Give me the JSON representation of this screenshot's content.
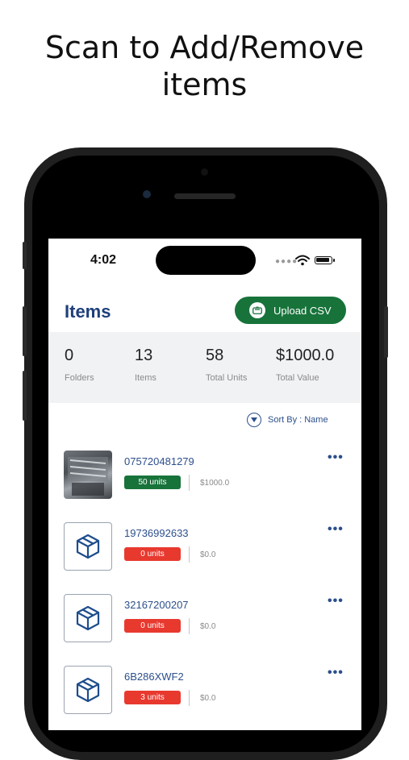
{
  "headline": "Scan to Add/Remove items",
  "status_bar": {
    "time": "4:02"
  },
  "header": {
    "title": "Items",
    "upload_label": "Upload CSV"
  },
  "stats": [
    {
      "value": "0",
      "label": "Folders"
    },
    {
      "value": "13",
      "label": "Items"
    },
    {
      "value": "58",
      "label": "Total Units"
    },
    {
      "value": "$1000.0",
      "label": "Total Value"
    }
  ],
  "sort_label": "Sort By : Name",
  "items": [
    {
      "name": "075720481279",
      "units": "50 units",
      "price": "$1000.0",
      "thumb": "photo",
      "badge_color": "#17733a"
    },
    {
      "name": "19736992633",
      "units": "0 units",
      "price": "$0.0",
      "thumb": "box-icon",
      "badge_color": "#e8392f"
    },
    {
      "name": "32167200207",
      "units": "0 units",
      "price": "$0.0",
      "thumb": "box-icon",
      "badge_color": "#e8392f"
    },
    {
      "name": "6B286XWF2",
      "units": "3 units",
      "price": "$0.0",
      "thumb": "box-icon",
      "badge_color": "#e8392f"
    }
  ],
  "colors": {
    "brand_blue": "#1e3f7a",
    "accent_green": "#17733a",
    "alert_red": "#e8392f"
  }
}
